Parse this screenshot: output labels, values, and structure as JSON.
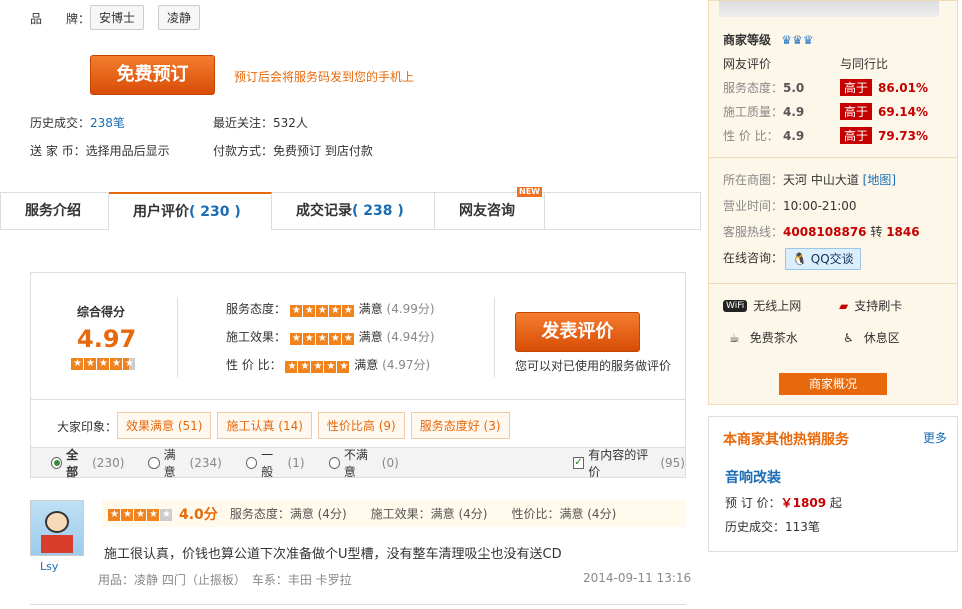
{
  "brand": {
    "label": "品　　牌：",
    "tags": [
      "安博士",
      "凌静"
    ]
  },
  "book": {
    "button": "免费预订",
    "hint": "预订后会将服务码发到您的手机上"
  },
  "info": {
    "history_label": "历史成交：",
    "history_value": "238笔",
    "attention_label": "最近关注：",
    "attention_value": "532人",
    "coin_label": "送 家 币：",
    "coin_value": "选择用品后显示",
    "pay_label": "付款方式：",
    "pay_value": "免费预订 到店付款"
  },
  "tabs": [
    {
      "label": "服务介绍"
    },
    {
      "label": "用户评价",
      "count": "( 230 )"
    },
    {
      "label": "成交记录",
      "count": "( 238 )"
    },
    {
      "label": "网友咨询",
      "badge": "NEW"
    }
  ],
  "score": {
    "title": "综合得分",
    "value": "4.97",
    "rows": [
      {
        "label": "服务态度：",
        "text": "满意",
        "score": "(4.99分)"
      },
      {
        "label": "施工效果：",
        "text": "满意",
        "score": "(4.94分)"
      },
      {
        "label": "性 价 比：",
        "text": "满意",
        "score": "(4.97分)"
      }
    ],
    "post_button": "发表评价",
    "post_hint": "您可以对已使用的服务做评价"
  },
  "impression": {
    "label": "大家印象：",
    "tags": [
      "效果满意 (51)",
      "施工认真 (14)",
      "性价比高 (9)",
      "服务态度好 (3)"
    ]
  },
  "filters": [
    {
      "label": "全部",
      "count": "(230)",
      "checked": true
    },
    {
      "label": "满意",
      "count": "(234)",
      "checked": false
    },
    {
      "label": "一般",
      "count": "(1)",
      "checked": false
    },
    {
      "label": "不满意",
      "count": "(0)",
      "checked": false
    }
  ],
  "content_filter": {
    "label": "有内容的评价",
    "count": "(95)"
  },
  "review": {
    "user": "Lsy",
    "rating": "4.0分",
    "details": "服务态度：满意 (4分)　　施工效果：满意 (4分)　　性价比：满意 (4分)",
    "text": "施工很认真，价钱也算公道下次准备做个U型槽，没有整车清理吸尘也没有送CD",
    "product": "用品：凌静 四门（止振板）　车系：丰田 卡罗拉",
    "time": "2014-09-11 13:16"
  },
  "merchant": {
    "level_label": "商家等级",
    "col1": "网友评价",
    "col2": "与同行比",
    "ratings": [
      {
        "label": "服务态度：",
        "value": "5.0",
        "badge": "高于",
        "pct": "86.01%"
      },
      {
        "label": "施工质量：",
        "value": "4.9",
        "badge": "高于",
        "pct": "69.14%"
      },
      {
        "label": "性 价 比：",
        "value": "4.9",
        "badge": "高于",
        "pct": "79.73%"
      }
    ],
    "circle_label": "所在商圈：",
    "circle_value": "天河 中山大道",
    "map_link": "[地图]",
    "hours_label": "营业时间：",
    "hours_value": "10:00-21:00",
    "phone_label": "客服热线：",
    "phone_value": "4008108876",
    "ext_label": "转",
    "ext_value": "1846",
    "qq_label": "在线咨询：",
    "qq_button": "QQ交谈",
    "amenities": [
      "无线上网",
      "支持刷卡",
      "免费茶水",
      "休息区"
    ],
    "overview_button": "商家概况"
  },
  "hot": {
    "title": "本商家其他热销服务",
    "more": "更多",
    "item_name": "音响改装",
    "price_label": "预 订 价：",
    "price_value": "￥1809",
    "price_suffix": "起",
    "history_label": "历史成交：",
    "history_value": "113笔"
  }
}
